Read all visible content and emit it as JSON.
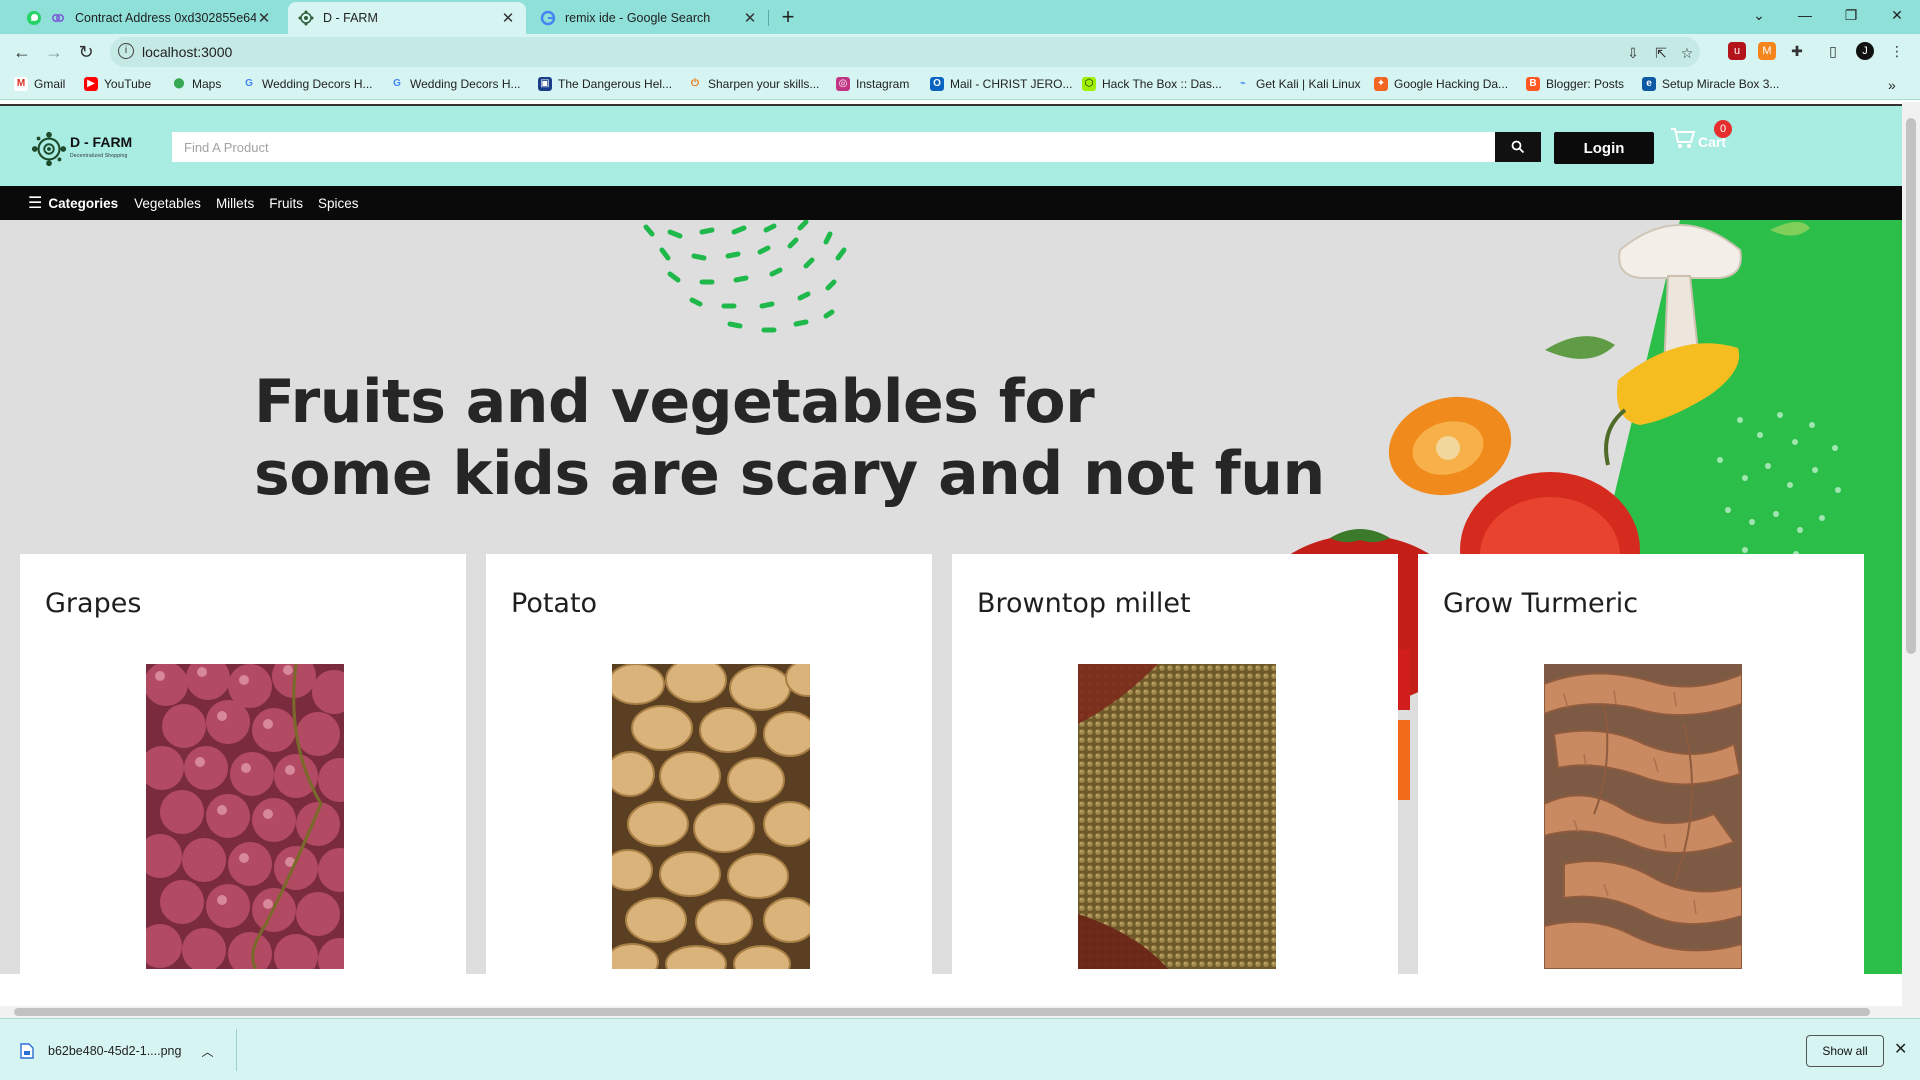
{
  "browser": {
    "tabs": [
      {
        "title": "Contract Address 0xd302855e64",
        "icon": "whatsapp-icon",
        "active": false
      },
      {
        "title": "D - FARM",
        "icon": "dfarm-favicon",
        "active": true
      },
      {
        "title": "remix ide - Google Search",
        "icon": "google-icon",
        "active": false
      }
    ],
    "url": "localhost:3000",
    "bookmarks": [
      {
        "label": "Gmail",
        "icon": "gmail-icon",
        "color": "#d93025"
      },
      {
        "label": "YouTube",
        "icon": "youtube-icon",
        "color": "#ff0000"
      },
      {
        "label": "Maps",
        "icon": "maps-icon",
        "color": "#34a853"
      },
      {
        "label": "Wedding Decors H...",
        "icon": "google-icon",
        "color": "#4285f4"
      },
      {
        "label": "Wedding Decors H...",
        "icon": "google-icon",
        "color": "#4285f4"
      },
      {
        "label": "The Dangerous Hel...",
        "icon": "bookmark-icon",
        "color": "#1a3f8a"
      },
      {
        "label": "Sharpen your skills...",
        "icon": "power-icon",
        "color": "#e8710a"
      },
      {
        "label": "Instagram",
        "icon": "instagram-icon",
        "color": "#c13584"
      },
      {
        "label": "Mail - CHRIST JERO...",
        "icon": "outlook-icon",
        "color": "#0a64c2"
      },
      {
        "label": "Hack The Box :: Das...",
        "icon": "htb-icon",
        "color": "#9fef00"
      },
      {
        "label": "Get Kali | Kali Linux",
        "icon": "kali-icon",
        "color": "#367bf0"
      },
      {
        "label": "Google Hacking Da...",
        "icon": "exploitdb-icon",
        "color": "#f26522"
      },
      {
        "label": "Blogger: Posts",
        "icon": "blogger-icon",
        "color": "#ff5722"
      },
      {
        "label": "Setup Miracle Box 3...",
        "icon": "edge-icon",
        "color": "#0c59a4"
      }
    ],
    "download": {
      "filename": "b62be480-45d2-1....png",
      "show_all": "Show all"
    }
  },
  "site": {
    "logo_text": "D - FARM",
    "logo_sub": "Decentralized Shopping",
    "search_placeholder": "Find A Product",
    "login_label": "Login",
    "cart_label": "Cart",
    "cart_count": "0",
    "nav": {
      "categories_label": "Categories",
      "links": [
        "Vegetables",
        "Millets",
        "Fruits",
        "Spices"
      ]
    },
    "hero": {
      "line1": "Fruits and vegetables for",
      "line2": "some kids are scary and not fun"
    },
    "products": [
      {
        "name": "Grapes",
        "image": "grapes-photo"
      },
      {
        "name": "Potato",
        "image": "potato-photo"
      },
      {
        "name": "Browntop millet",
        "image": "millet-photo"
      },
      {
        "name": "Grow Turmeric",
        "image": "turmeric-photo"
      }
    ]
  },
  "colors": {
    "tabstrip": "#8fe0d9",
    "header": "#a8ece2",
    "brand_green": "#2bbf4a",
    "nav_bg": "#0a0a0a"
  }
}
